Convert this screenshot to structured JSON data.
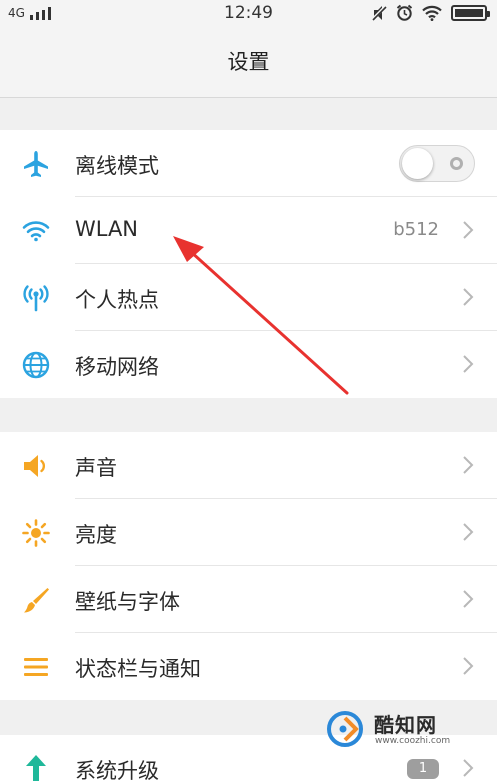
{
  "status_bar": {
    "network": "4G",
    "time": "12:49",
    "icons": [
      "signal-icon",
      "mute-icon",
      "alarm-icon",
      "wifi-icon",
      "battery-icon"
    ]
  },
  "header": {
    "title": "设置"
  },
  "groups": [
    {
      "items": [
        {
          "label": "离线模式",
          "icon": "airplane-icon",
          "control": "toggle",
          "toggle_on": false
        },
        {
          "label": "WLAN",
          "icon": "wifi-icon",
          "value": "b512"
        },
        {
          "label": "个人热点",
          "icon": "hotspot-icon"
        },
        {
          "label": "移动网络",
          "icon": "globe-icon"
        }
      ]
    },
    {
      "items": [
        {
          "label": "声音",
          "icon": "speaker-icon"
        },
        {
          "label": "亮度",
          "icon": "brightness-icon"
        },
        {
          "label": "壁纸与字体",
          "icon": "brush-icon"
        },
        {
          "label": "状态栏与通知",
          "icon": "menu-lines-icon"
        }
      ]
    },
    {
      "items": [
        {
          "label": "系统升级",
          "icon": "upgrade-arrow-icon",
          "badge": "1"
        }
      ]
    }
  ],
  "watermark": {
    "name": "酷知网",
    "url": "www.coozhi.com"
  },
  "colors": {
    "blue_icon": "#2ba3e0",
    "orange_icon": "#f5a623",
    "green_icon": "#1fb89a",
    "annotation_arrow": "#e8322f"
  }
}
